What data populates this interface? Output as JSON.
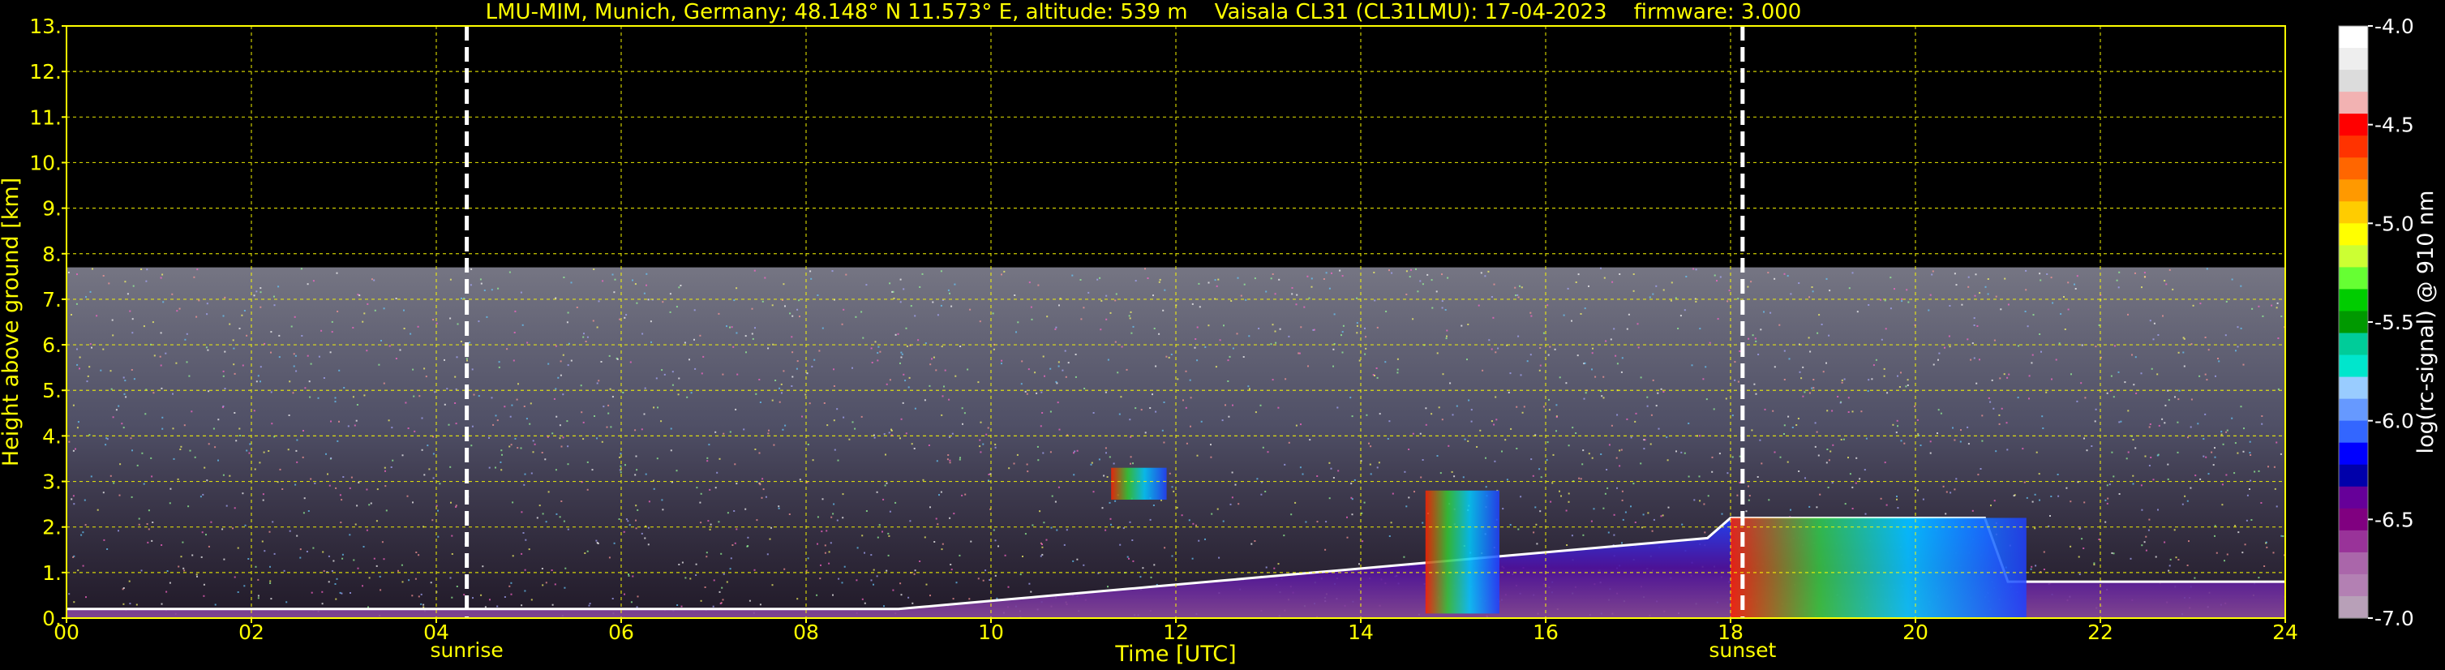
{
  "title": {
    "site": "LMU-MIM, Munich, Germany; 48.148° N 11.573° E, altitude: 539 m",
    "instrument": "Vaisala CL31 (CL31LMU): 17-04-2023",
    "firmware": "firmware: 3.000"
  },
  "chart_data": {
    "type": "heatmap",
    "xlabel": "Time [UTC]",
    "ylabel": "Height above ground [km]",
    "xlim": [
      0,
      24
    ],
    "ylim": [
      0,
      13
    ],
    "x_ticks": [
      "00",
      "02",
      "04",
      "06",
      "08",
      "10",
      "12",
      "14",
      "16",
      "18",
      "20",
      "22",
      "24"
    ],
    "y_ticks": [
      "0.",
      "1.",
      "2.",
      "3.",
      "4.",
      "5.",
      "6.",
      "7.",
      "8.",
      "9.",
      "10.",
      "11.",
      "12.",
      "13."
    ],
    "grid": true,
    "annotations": [
      {
        "label": "sunrise",
        "time_utc": 4.33
      },
      {
        "label": "sunset",
        "time_utc": 18.13
      }
    ],
    "colorbar": {
      "label": "log(rc-signal) @ 910 nm",
      "range": [
        -7.0,
        -4.0
      ],
      "ticks": [
        "-4.0",
        "-4.5",
        "-5.0",
        "-5.5",
        "-6.0",
        "-6.5",
        "-7.0"
      ],
      "colors": [
        "#ffffff",
        "#eeeeee",
        "#dcdcdc",
        "#f2b2b2",
        "#ff0000",
        "#ff3300",
        "#ff6600",
        "#ff9900",
        "#ffcc00",
        "#ffff00",
        "#ccff33",
        "#66ff33",
        "#00cc00",
        "#009900",
        "#00cc99",
        "#00e6cc",
        "#99ccff",
        "#6699ff",
        "#3366ff",
        "#0000ff",
        "#0000aa",
        "#660099",
        "#800080",
        "#993399",
        "#aa66aa",
        "#b380b3",
        "#b8a0b8"
      ]
    },
    "signal_features": [
      {
        "name": "aerosol boundary layer top",
        "time_utc": [
          0,
          24
        ],
        "height_km": [
          0.2,
          2.2
        ]
      },
      {
        "name": "clouds",
        "time_utc": [
          11.3,
          11.9
        ],
        "height_km": [
          2.6,
          3.3
        ]
      },
      {
        "name": "clouds",
        "time_utc": [
          14.7,
          15.5
        ],
        "height_km": [
          0.1,
          2.8
        ]
      },
      {
        "name": "clouds",
        "time_utc": [
          18.0,
          21.2
        ],
        "height_km": [
          0.0,
          2.2
        ]
      },
      {
        "name": "noise limit",
        "time_utc": [
          0,
          24
        ],
        "height_km": [
          7.7,
          7.7
        ]
      }
    ]
  }
}
